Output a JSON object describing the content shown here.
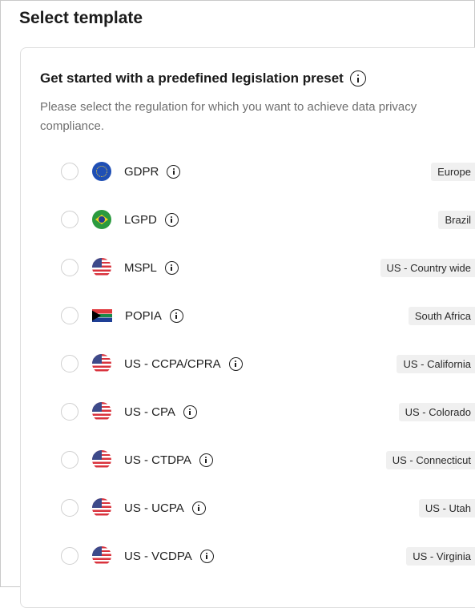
{
  "page": {
    "title": "Select template"
  },
  "card": {
    "title": "Get started with a predefined legislation preset",
    "description": "Please select the regulation for which you want to achieve data privacy compliance."
  },
  "presets": [
    {
      "name": "GDPR",
      "region": "Europe",
      "flag": "eu-flag-icon"
    },
    {
      "name": "LGPD",
      "region": "Brazil",
      "flag": "brazil-flag-icon"
    },
    {
      "name": "MSPL",
      "region": "US - Country wide",
      "flag": "us-flag-icon"
    },
    {
      "name": "POPIA",
      "region": "South Africa",
      "flag": "south-africa-flag-icon"
    },
    {
      "name": "US - CCPA/CPRA",
      "region": "US - California",
      "flag": "us-flag-icon"
    },
    {
      "name": "US - CPA",
      "region": "US - Colorado",
      "flag": "us-flag-icon"
    },
    {
      "name": "US - CTDPA",
      "region": "US - Connecticut",
      "flag": "us-flag-icon"
    },
    {
      "name": "US - UCPA",
      "region": "US - Utah",
      "flag": "us-flag-icon"
    },
    {
      "name": "US - VCDPA",
      "region": "US - Virginia",
      "flag": "us-flag-icon"
    }
  ]
}
